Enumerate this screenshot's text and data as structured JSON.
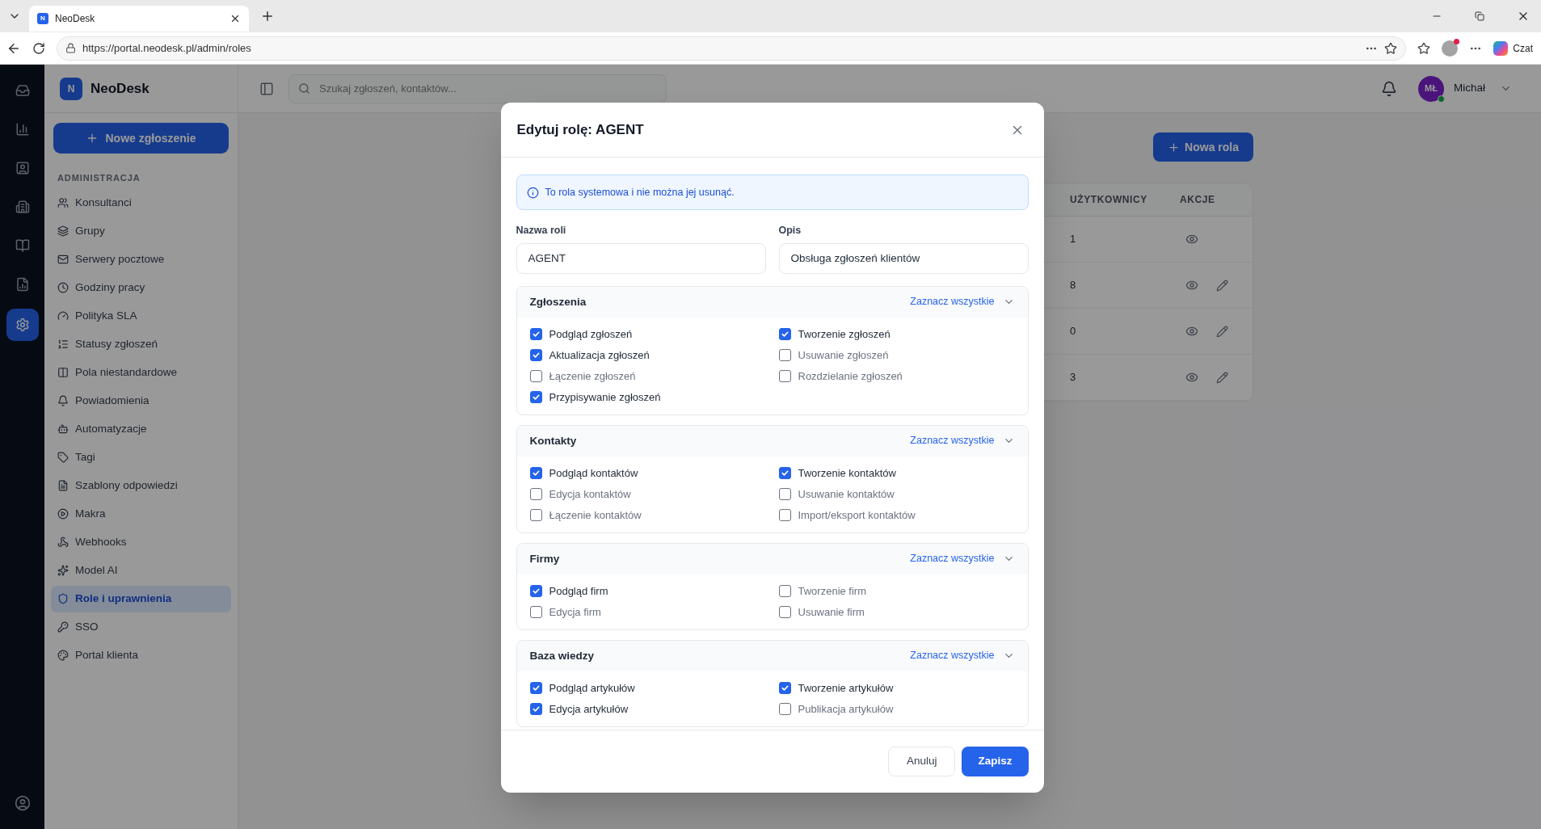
{
  "browser": {
    "tab_title": "NeoDesk",
    "favicon_letter": "N",
    "url": "https://portal.neodesk.pl/admin/roles",
    "copilot_label": "Czat"
  },
  "rail": [
    {
      "selected": false
    },
    {
      "selected": false
    },
    {
      "selected": false
    },
    {
      "selected": false
    },
    {
      "selected": false
    },
    {
      "selected": false
    },
    {
      "selected": true
    }
  ],
  "sidebar": {
    "logo_letter": "N",
    "app_name": "NeoDesk",
    "new_ticket": "Nowe zgłoszenie",
    "section": "ADMINISTRACJA",
    "items": [
      {
        "label": "Konsultanci",
        "selected": false
      },
      {
        "label": "Grupy",
        "selected": false
      },
      {
        "label": "Serwery pocztowe",
        "selected": false
      },
      {
        "label": "Godziny pracy",
        "selected": false
      },
      {
        "label": "Polityka SLA",
        "selected": false
      },
      {
        "label": "Statusy zgłoszeń",
        "selected": false
      },
      {
        "label": "Pola niestandardowe",
        "selected": false
      },
      {
        "label": "Powiadomienia",
        "selected": false
      },
      {
        "label": "Automatyzacje",
        "selected": false
      },
      {
        "label": "Tagi",
        "selected": false
      },
      {
        "label": "Szablony odpowiedzi",
        "selected": false
      },
      {
        "label": "Makra",
        "selected": false
      },
      {
        "label": "Webhooks",
        "selected": false
      },
      {
        "label": "Model AI",
        "selected": false
      },
      {
        "label": "Role i uprawnienia",
        "selected": true
      },
      {
        "label": "SSO",
        "selected": false
      },
      {
        "label": "Portal klienta",
        "selected": false
      }
    ]
  },
  "header": {
    "search_placeholder": "Szukaj zgłoszeń, kontaktów...",
    "user_initials": "MŁ",
    "user_name": "Michał",
    "online": true
  },
  "page": {
    "new_role": "Nowa rola",
    "columns": [
      "UŻYTKOWNICY",
      "AKCJE"
    ],
    "rows": [
      {
        "users": "1",
        "editable": false
      },
      {
        "users": "8",
        "editable": true
      },
      {
        "users": "0",
        "editable": true
      },
      {
        "users": "3",
        "editable": true
      }
    ]
  },
  "modal": {
    "title": "Edytuj rolę: AGENT",
    "notice": "To rola systemowa i nie można jej usunąć.",
    "fields": [
      {
        "label": "Nazwa roli",
        "value": "AGENT"
      },
      {
        "label": "Opis",
        "value": "Obsługa zgłoszeń klientów"
      }
    ],
    "sections": [
      {
        "title": "Zgłoszenia",
        "select_all": "Zaznacz wszystkie",
        "permissions": [
          {
            "label": "Podgląd zgłoszeń",
            "checked": true
          },
          {
            "label": "Tworzenie zgłoszeń",
            "checked": true
          },
          {
            "label": "Aktualizacja zgłoszeń",
            "checked": true
          },
          {
            "label": "Usuwanie zgłoszeń",
            "checked": false
          },
          {
            "label": "Łączenie zgłoszeń",
            "checked": false
          },
          {
            "label": "Rozdzielanie zgłoszeń",
            "checked": false
          },
          {
            "label": "Przypisywanie zgłoszeń",
            "checked": true
          }
        ]
      },
      {
        "title": "Kontakty",
        "select_all": "Zaznacz wszystkie",
        "permissions": [
          {
            "label": "Podgląd kontaktów",
            "checked": true
          },
          {
            "label": "Tworzenie kontaktów",
            "checked": true
          },
          {
            "label": "Edycja kontaktów",
            "checked": false
          },
          {
            "label": "Usuwanie kontaktów",
            "checked": false
          },
          {
            "label": "Łączenie kontaktów",
            "checked": false
          },
          {
            "label": "Import/eksport kontaktów",
            "checked": false
          }
        ]
      },
      {
        "title": "Firmy",
        "select_all": "Zaznacz wszystkie",
        "permissions": [
          {
            "label": "Podgląd firm",
            "checked": true
          },
          {
            "label": "Tworzenie firm",
            "checked": false
          },
          {
            "label": "Edycja firm",
            "checked": false
          },
          {
            "label": "Usuwanie firm",
            "checked": false
          }
        ]
      },
      {
        "title": "Baza wiedzy",
        "select_all": "Zaznacz wszystkie",
        "permissions": [
          {
            "label": "Podgląd artykułów",
            "checked": true
          },
          {
            "label": "Tworzenie artykułów",
            "checked": true
          },
          {
            "label": "Edycja artykułów",
            "checked": true
          },
          {
            "label": "Publikacja artykułów",
            "checked": false
          }
        ]
      }
    ],
    "cancel": "Anuluj",
    "save": "Zapisz"
  }
}
